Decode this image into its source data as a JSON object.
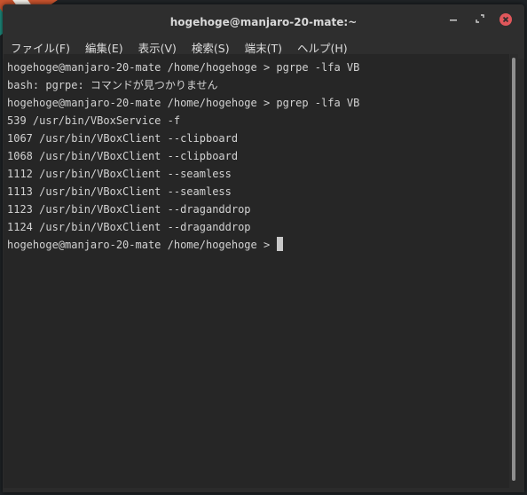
{
  "window": {
    "title": "hogehoge@manjaro-20-mate:~",
    "controls": {
      "minimize": "−",
      "maximize": "⤴",
      "close": "✕"
    }
  },
  "menubar": {
    "items": [
      {
        "label": "ファイル(F)"
      },
      {
        "label": "編集(E)"
      },
      {
        "label": "表示(V)"
      },
      {
        "label": "検索(S)"
      },
      {
        "label": "端末(T)"
      },
      {
        "label": "ヘルプ(H)"
      }
    ]
  },
  "terminal": {
    "lines": [
      "hogehoge@manjaro-20-mate /home/hogehoge > pgrpe -lfa VB",
      "bash: pgrpe: コマンドが見つかりません",
      "hogehoge@manjaro-20-mate /home/hogehoge > pgrep -lfa VB",
      "539 /usr/bin/VBoxService -f",
      "1067 /usr/bin/VBoxClient --clipboard",
      "1068 /usr/bin/VBoxClient --clipboard",
      "1112 /usr/bin/VBoxClient --seamless",
      "1113 /usr/bin/VBoxClient --seamless",
      "1123 /usr/bin/VBoxClient --draganddrop",
      "1124 /usr/bin/VBoxClient --draganddrop"
    ],
    "prompt": "hogehoge@manjaro-20-mate /home/hogehoge > "
  }
}
